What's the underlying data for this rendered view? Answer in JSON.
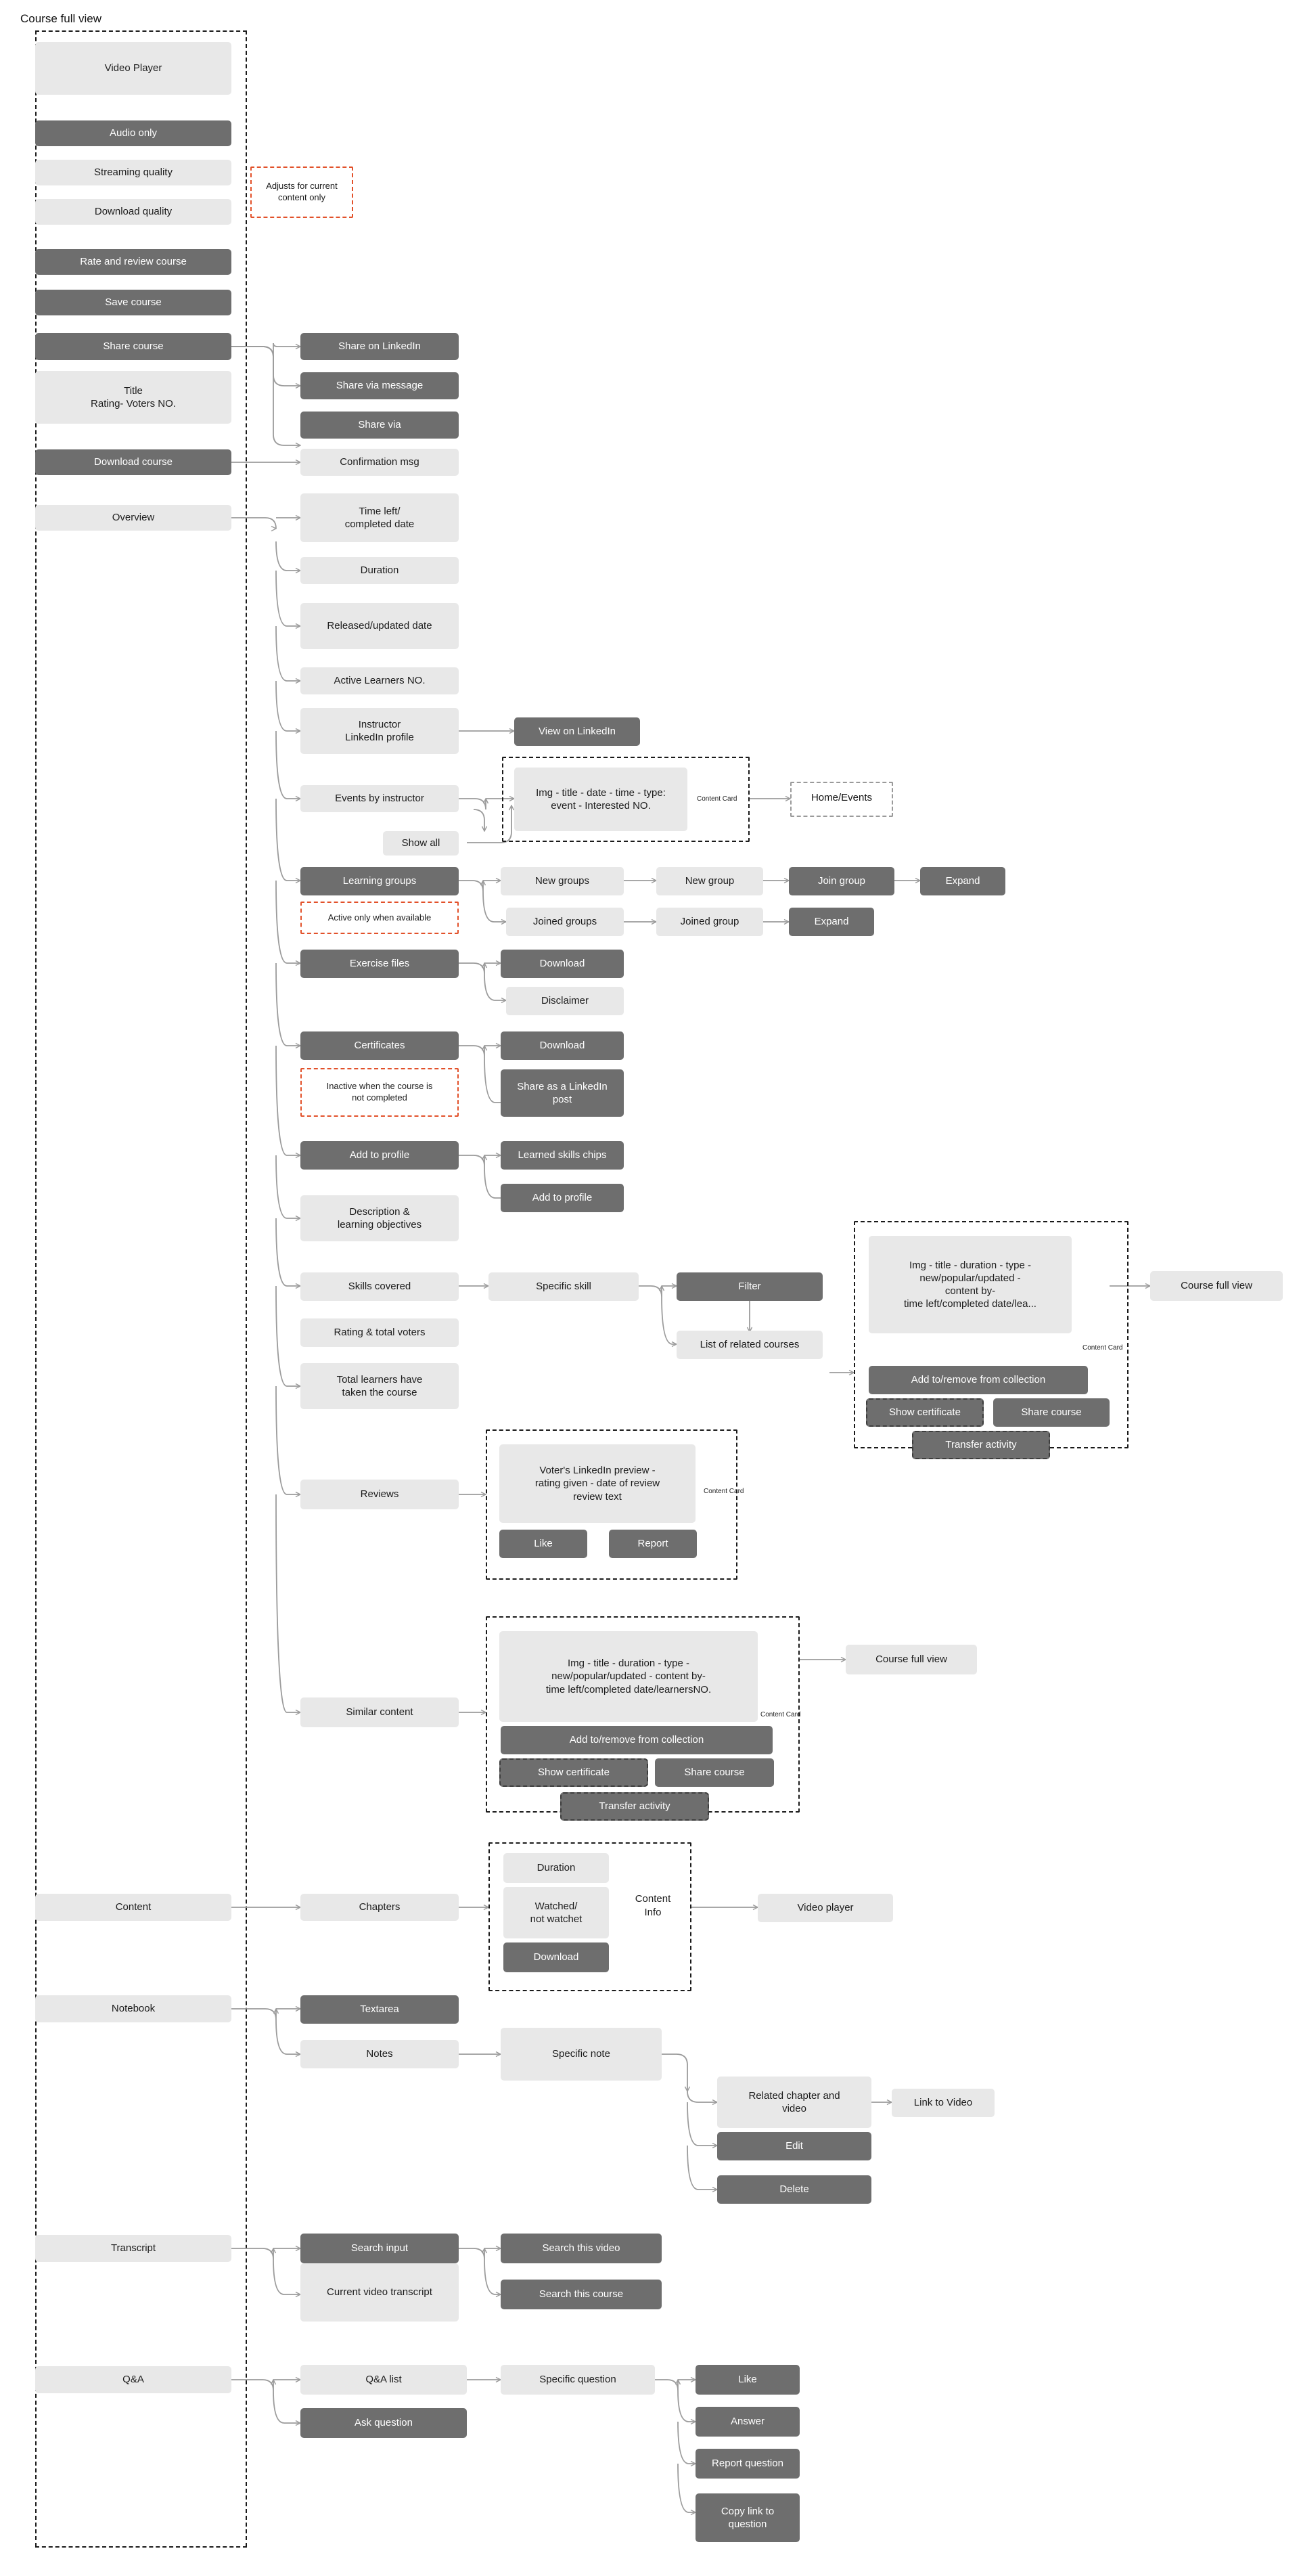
{
  "title": "Course full view",
  "colors": {
    "light_node": "#e8e8e8",
    "dark_node": "#6e6e6e",
    "note_border": "#e2512a",
    "frame_border": "#1a1a1a",
    "connector": "#9b9b9b",
    "text_dark": "#1c1c1c",
    "text_light": "#ffffff"
  },
  "nodes": {
    "video_player": "Video Player",
    "audio_only": "Audio only",
    "streaming_quality": "Streaming quality",
    "download_quality": "Download quality",
    "rate_and_review_course": "Rate and review course",
    "save_course": "Save course",
    "share_course": "Share course",
    "title_rating": "Title\nRating- Voters NO.",
    "download_course": "Download course",
    "overview": "Overview",
    "note_adjusts": "Adjusts for current\ncontent only",
    "share_on_linkedin": "Share on LinkedIn",
    "share_via_message": "Share via message",
    "share_via": "Share via",
    "confirmation_msg": "Confirmation msg",
    "time_left": "Time left/\ncompleted date",
    "duration": "Duration",
    "released_updated_date": "Released/updated date",
    "active_learners_no": "Active Learners NO.",
    "instructor_linkedin_profile": "Instructor\nLinkedIn profile",
    "view_on_linkedin": "View on LinkedIn",
    "events_by_instructor": "Events by instructor",
    "show_all": "Show all",
    "event_card_text": "Img - title - date - time - type:\nevent - Interested NO.",
    "content_card_label": "Content Card",
    "home_events": "Home/Events",
    "learning_groups": "Learning groups",
    "note_active_only": "Active only when available",
    "new_groups": "New groups",
    "new_group": "New group",
    "join_group": "Join group",
    "expand": "Expand",
    "joined_groups": "Joined groups",
    "joined_group": "Joined group",
    "expand2": "Expand",
    "exercise_files": "Exercise files",
    "download": "Download",
    "disclaimer": "Disclaimer",
    "certificates": "Certificates",
    "download2": "Download",
    "note_inactive": "Inactive when the course is\nnot completed",
    "share_as_linkedin_post": "Share as a LinkedIn\npost",
    "add_to_profile": "Add to profile",
    "learned_skills_chips": "Learned skills chips",
    "add_to_profile2": "Add to profile",
    "description_objectives": "Description &\nlearning objectives",
    "skills_covered": "Skills covered",
    "specific_skill": "Specific skill",
    "filter": "Filter",
    "list_of_related_courses": "List of related courses",
    "rating_total_voters": "Rating & total voters",
    "total_learners": "Total learners have\ntaken the course",
    "course_card_text_a": "Img - title - duration - type -\nnew/popular/updated -\ncontent by-\ntime left/completed date/lea...",
    "course_full_view_a": "Course full view",
    "add_remove_collection_a": "Add to/remove from collection",
    "show_certificate_a": "Show certificate",
    "share_course_a": "Share course",
    "transfer_activity_a": "Transfer activity",
    "reviews": "Reviews",
    "review_card_text": "Voter's LinkedIn preview -\nrating given - date of review\nreview text",
    "like": "Like",
    "report": "Report",
    "similar_content": "Similar content",
    "course_card_text_b": "Img - title - duration - type -\nnew/popular/updated - content by-\ntime left/completed date/learnersNO.",
    "course_full_view_b": "Course full view",
    "add_remove_collection_b": "Add to/remove from collection",
    "show_certificate_b": "Show certificate",
    "share_course_b": "Share course",
    "transfer_activity_b": "Transfer activity",
    "content": "Content",
    "chapters": "Chapters",
    "duration2": "Duration",
    "watched_not_watched": "Watched/\nnot watchet",
    "download3": "Download",
    "content_info": "Content\nInfo",
    "video_player2": "Video player",
    "notebook": "Notebook",
    "textarea": "Textarea",
    "notes": "Notes",
    "specific_note": "Specific note",
    "related_chapter_and_video": "Related chapter and\nvideo",
    "link_to_video": "Link to Video",
    "edit": "Edit",
    "delete": "Delete",
    "transcript": "Transcript",
    "search_input": "Search input",
    "search_this_video": "Search this video",
    "search_this_course": "Search this course",
    "current_video_transcript": "Current video transcript",
    "qa": "Q&A",
    "qa_list": "Q&A list",
    "ask_question": "Ask question",
    "specific_question": "Specific question",
    "like2": "Like",
    "answer": "Answer",
    "report_question": "Report question",
    "copy_link_to_question": "Copy link to\nquestion"
  }
}
